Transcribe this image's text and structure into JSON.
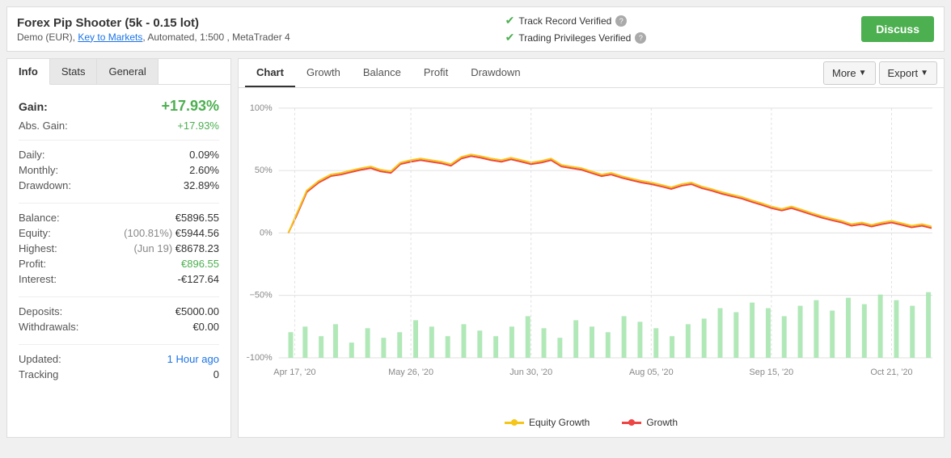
{
  "header": {
    "title": "Forex Pip Shooter (5k - 0.15 lot)",
    "subtitle": "Demo (EUR), Key to Markets, Automated, 1:500 , MetaTrader 4",
    "track_record": "Track Record Verified",
    "trading_privileges": "Trading Privileges Verified",
    "discuss_label": "Discuss"
  },
  "left_panel": {
    "tabs": [
      "Info",
      "Stats",
      "General"
    ],
    "active_tab": "Info",
    "gain_label": "Gain:",
    "gain_value": "+17.93%",
    "abs_gain_label": "Abs. Gain:",
    "abs_gain_value": "+17.93%",
    "stats": [
      {
        "label": "Daily:",
        "value": "0.09%"
      },
      {
        "label": "Monthly:",
        "value": "2.60%"
      },
      {
        "label": "Drawdown:",
        "value": "32.89%"
      }
    ],
    "stats2": [
      {
        "label": "Balance:",
        "value": "€5896.55"
      },
      {
        "label": "Equity:",
        "value": "(100.81%) €5944.56"
      },
      {
        "label": "Highest:",
        "value": "(Jun 19) €8678.23"
      },
      {
        "label": "Profit:",
        "value": "€896.55",
        "color": "green"
      },
      {
        "label": "Interest:",
        "value": "-€127.64"
      }
    ],
    "stats3": [
      {
        "label": "Deposits:",
        "value": "€5000.00"
      },
      {
        "label": "Withdrawals:",
        "value": "€0.00"
      }
    ],
    "stats4": [
      {
        "label": "Updated:",
        "value": "1 Hour ago",
        "color": "blue"
      },
      {
        "label": "Tracking",
        "value": "0"
      }
    ]
  },
  "right_panel": {
    "tabs": [
      "Chart",
      "Growth",
      "Balance",
      "Profit",
      "Drawdown"
    ],
    "active_tab": "Chart",
    "more_label": "More",
    "export_label": "Export",
    "y_axis_labels": [
      "100%",
      "50%",
      "0%",
      "-50%",
      "-100%"
    ],
    "x_axis_labels": [
      "Apr 17, '20",
      "May 26, '20",
      "Jun 30, '20",
      "Aug 05, '20",
      "Sep 15, '20",
      "Oct 21, '20"
    ],
    "legend": [
      {
        "label": "Equity Growth",
        "color": "yellow"
      },
      {
        "label": "Growth",
        "color": "red"
      }
    ]
  }
}
